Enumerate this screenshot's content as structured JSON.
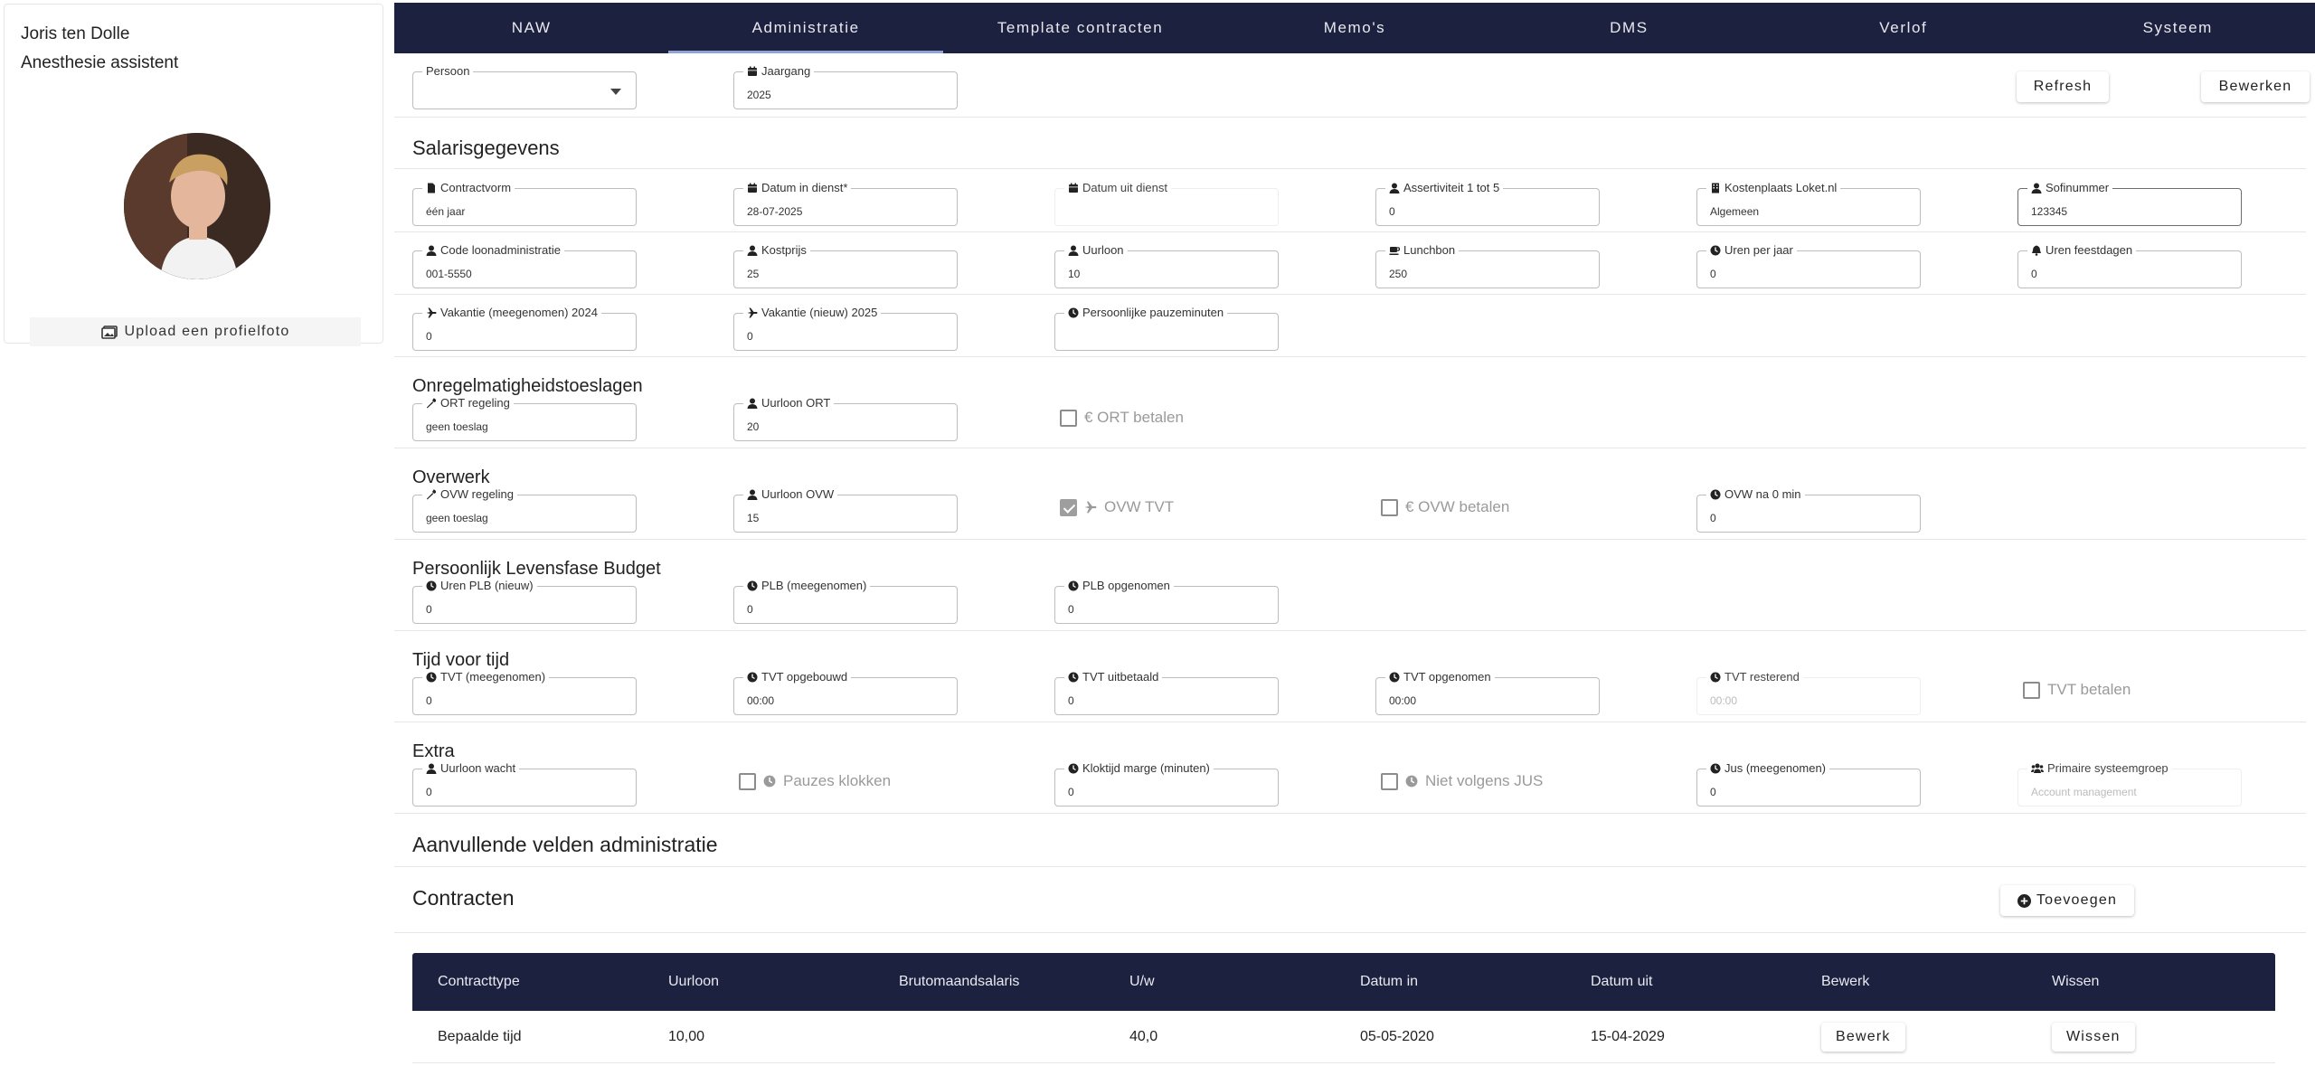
{
  "profile": {
    "name": "Joris ten Dolle",
    "role": "Anesthesie assistent",
    "upload_label": "Upload een profielfoto"
  },
  "nav": {
    "tabs": [
      "NAW",
      "Administratie",
      "Template contracten",
      "Memo's",
      "DMS",
      "Verlof",
      "Systeem"
    ],
    "active": "Administratie"
  },
  "toolbar": {
    "persoon": {
      "label": "Persoon",
      "value": ""
    },
    "jaargang": {
      "label": "Jaargang",
      "value": "2025"
    },
    "refresh_label": "Refresh",
    "bewerken_label": "Bewerken"
  },
  "salaris": {
    "title": "Salarisgegevens",
    "contractvorm": {
      "label": "Contractvorm",
      "value": "één jaar"
    },
    "datum_in_dienst": {
      "label": "Datum in dienst*",
      "value": "28-07-2025"
    },
    "datum_uit_dienst": {
      "label": "Datum uit dienst",
      "value": ""
    },
    "assertiviteit": {
      "label": "Assertiviteit 1 tot 5",
      "value": "0"
    },
    "kostenplaats": {
      "label": "Kostenplaats Loket.nl",
      "value": "Algemeen"
    },
    "sofinummer": {
      "label": "Sofinummer",
      "value": "123345"
    },
    "code_loonadmin": {
      "label": "Code loonadministratie",
      "value": "001-5550"
    },
    "kostprijs": {
      "label": "Kostprijs",
      "value": "25"
    },
    "uurloon": {
      "label": "Uurloon",
      "value": "10"
    },
    "lunchbon": {
      "label": "Lunchbon",
      "value": "250"
    },
    "uren_per_jaar": {
      "label": "Uren per jaar",
      "value": "0"
    },
    "uren_feestdagen": {
      "label": "Uren feestdagen",
      "value": "0"
    },
    "vakantie_mee": {
      "label": "Vakantie (meegenomen) 2024",
      "value": "0"
    },
    "vakantie_nieuw": {
      "label": "Vakantie (nieuw) 2025",
      "value": "0"
    },
    "pauzeminuten": {
      "label": "Persoonlijke pauzeminuten",
      "value": ""
    }
  },
  "ort": {
    "title": "Onregelmatigheidstoeslagen",
    "regeling": {
      "label": "ORT regeling",
      "value": "geen toeslag"
    },
    "uurloon": {
      "label": "Uurloon ORT",
      "value": "20"
    },
    "betalen_label": "€ ORT betalen"
  },
  "ovw": {
    "title": "Overwerk",
    "regeling": {
      "label": "OVW regeling",
      "value": "geen toeslag"
    },
    "uurloon": {
      "label": "Uurloon OVW",
      "value": "15"
    },
    "tvt_label": "OVW TVT",
    "betalen_label": "€ OVW betalen",
    "na_min": {
      "label": "OVW na 0 min",
      "value": "0"
    }
  },
  "plb": {
    "title": "Persoonlijk Levensfase Budget",
    "uren_nieuw": {
      "label": "Uren PLB (nieuw)",
      "value": "0"
    },
    "meegenomen": {
      "label": "PLB (meegenomen)",
      "value": "0"
    },
    "opgenomen": {
      "label": "PLB opgenomen",
      "value": "0"
    }
  },
  "tvt": {
    "title": "Tijd voor tijd",
    "meegenomen": {
      "label": "TVT (meegenomen)",
      "value": "0"
    },
    "opgebouwd": {
      "label": "TVT opgebouwd",
      "value": "00:00"
    },
    "uitbetaald": {
      "label": "TVT uitbetaald",
      "value": "0"
    },
    "opgenomen": {
      "label": "TVT opgenomen",
      "value": "00:00"
    },
    "resterend": {
      "label": "TVT resterend",
      "value": "00:00"
    },
    "betalen_label": "TVT betalen"
  },
  "extra": {
    "title": "Extra",
    "uurloon_wacht": {
      "label": "Uurloon wacht",
      "value": "0"
    },
    "pauzes_label": "Pauzes klokken",
    "kloktijd": {
      "label": "Kloktijd marge (minuten)",
      "value": "0"
    },
    "niet_jus_label": "Niet volgens JUS",
    "jus": {
      "label": "Jus (meegenomen)",
      "value": "0"
    },
    "systeemgroep": {
      "label": "Primaire systeemgroep",
      "value": "Account management"
    }
  },
  "aanvullend": {
    "title": "Aanvullende velden administratie"
  },
  "contracten": {
    "title": "Contracten",
    "add_label": "Toevoegen",
    "columns": [
      "Contracttype",
      "Uurloon",
      "Brutomaandsalaris",
      "U/w",
      "Datum in",
      "Datum uit",
      "Bewerk",
      "Wissen"
    ],
    "rows": [
      {
        "type": "Bepaalde tijd",
        "uurloon": "10,00",
        "bruto": "",
        "uw": "40,0",
        "datum_in": "05-05-2020",
        "datum_uit": "15-04-2029",
        "edit_label": "Bewerk",
        "delete_label": "Wissen"
      }
    ]
  }
}
